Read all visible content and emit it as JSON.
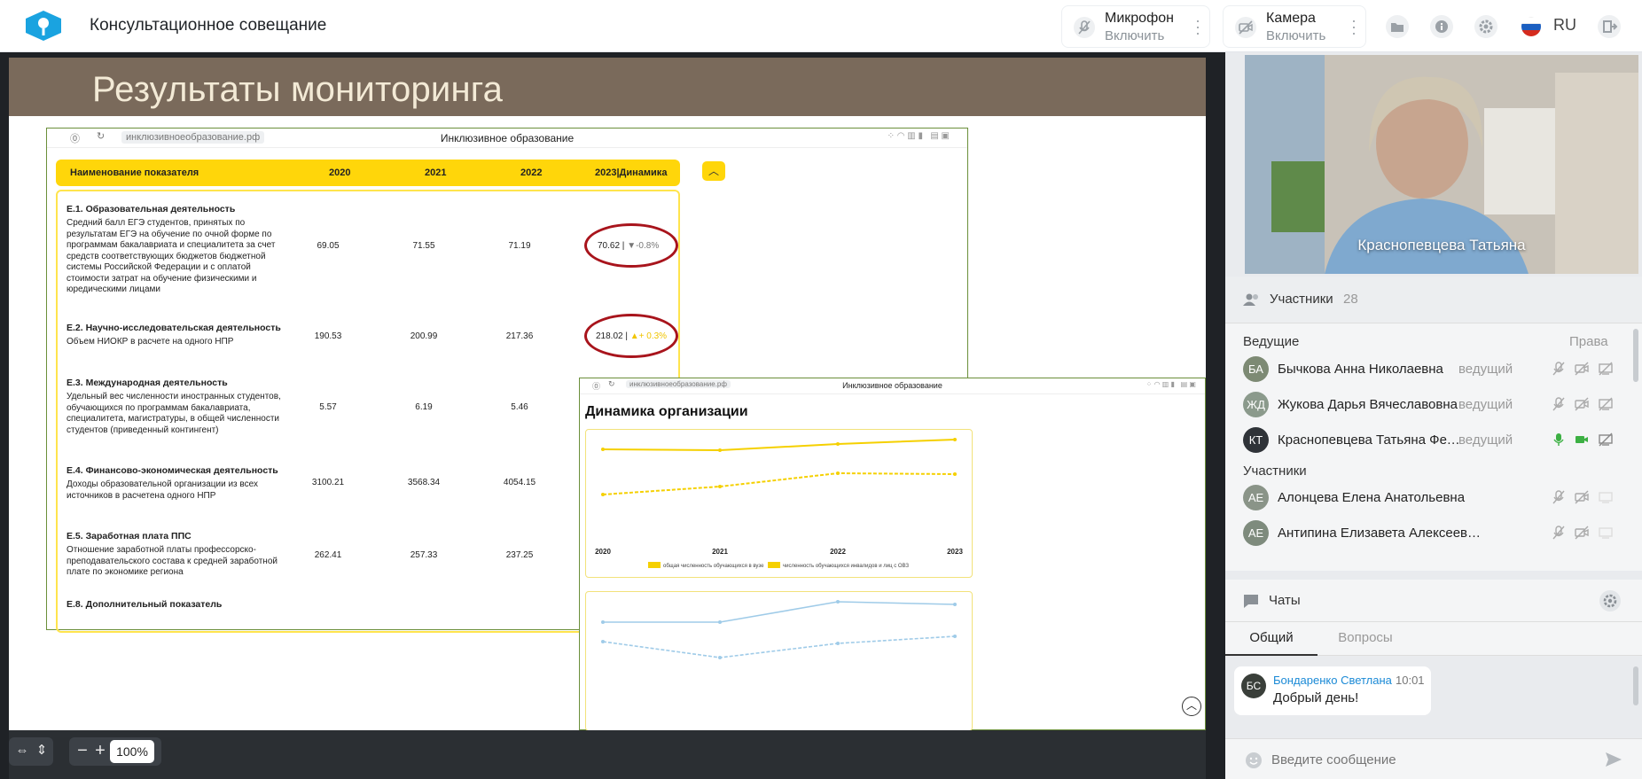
{
  "app": {
    "title": "Консультационное совещание",
    "language": "RU"
  },
  "devices": {
    "microphone": {
      "label": "Микрофон",
      "action": "Включить"
    },
    "camera": {
      "label": "Камера",
      "action": "Включить"
    }
  },
  "slide": {
    "title": "Результаты мониторинга",
    "browser1": {
      "url": "инклюзивноеобразование.рф",
      "caption": "Инклюзивное образование"
    },
    "table": {
      "headers": [
        "Наименование показателя",
        "2020",
        "2021",
        "2022",
        "2023|Динамика"
      ],
      "rows": [
        {
          "title": "Е.1. Образовательная деятельность",
          "desc": "Средний балл ЕГЭ студентов, принятых по результатам ЕГЭ на обучение по очной форме по программам бакалавриата и специалитета за счет средств соответствующих бюджетов бюджетной системы Российской Федерации и с оплатой стоимости затрат на обучение физическими и юредическими лицами",
          "v2020": "69.05",
          "v2021": "71.55",
          "v2022": "71.19",
          "v2023": "70.62",
          "dyn": "▼-0.8%"
        },
        {
          "title": "Е.2. Научно-исследовательская деятельность",
          "desc": "Объем НИОКР в расчете на одного НПР",
          "v2020": "190.53",
          "v2021": "200.99",
          "v2022": "217.36",
          "v2023": "218.02",
          "dyn": "▲+ 0.3%"
        },
        {
          "title": "Е.3. Международная деятельность",
          "desc": "Удельный вес численности иностранных студентов, обучающихся по программам бакалавриата, специалитета, магистратуры, в общей численности студентов (приведенный контингент)",
          "v2020": "5.57",
          "v2021": "6.19",
          "v2022": "5.46"
        },
        {
          "title": "Е.4. Финансово-экономическая деятельность",
          "desc": "Доходы образовательной организации из всех источников в расчетена одного НПР",
          "v2020": "3100.21",
          "v2021": "3568.34",
          "v2022": "4054.15"
        },
        {
          "title": "Е.5. Заработная плата ППС",
          "desc": "Отношение заработной платы профессорско-преподавательского состава к средней заработной плате по экономике региона",
          "v2020": "262.41",
          "v2021": "257.33",
          "v2022": "237.25"
        },
        {
          "title": "Е.8. Дополнительный показатель"
        }
      ]
    },
    "browser2": {
      "url": "инклюзивноеобразование.рф",
      "caption": "Инклюзивное образование",
      "heading": "Динамика организации"
    },
    "chart1": {
      "x": [
        "2020",
        "2021",
        "2022",
        "2023"
      ],
      "legend": [
        "общая численность обучающихся в вузе",
        "численность обучающихся инвалидов и лиц с ОВЗ"
      ],
      "color": "#f5d000"
    },
    "chart2": {
      "color": "#9fcbe8"
    }
  },
  "toolbar": {
    "zoom": "100%"
  },
  "video": {
    "name": "Краснопевцева Татьяна"
  },
  "participants": {
    "label": "Участники",
    "count": "28",
    "hosts_label": "Ведущие",
    "rights_label": "Права",
    "members_label": "Участники",
    "hosts": [
      {
        "initials": "БА",
        "name": "Бычкова Анна Николаевна",
        "role": "ведущий",
        "color": "#7d8a74"
      },
      {
        "initials": "ЖД",
        "name": "Жукова Дарья Вячеславовна",
        "role": "ведущий",
        "color": "#8b9a8c"
      },
      {
        "initials": "КТ",
        "name": "Краснопевцева Татьяна Фед...",
        "role": "ведущий",
        "color": "#2f3338"
      }
    ],
    "members": [
      {
        "initials": "АЕ",
        "name": "Алонцева Елена Анатольевна",
        "color": "#8a9488"
      },
      {
        "initials": "АЕ",
        "name": "Антипина Елизавета Алексеевна",
        "color": "#7e8b7d"
      }
    ]
  },
  "chats": {
    "label": "Чаты",
    "tabs": [
      "Общий",
      "Вопросы"
    ],
    "message": {
      "initials": "БС",
      "author": "Бондаренко Светлана",
      "time": "10:01",
      "text": "Добрый день!"
    },
    "input_placeholder": "Введите сообщение"
  }
}
